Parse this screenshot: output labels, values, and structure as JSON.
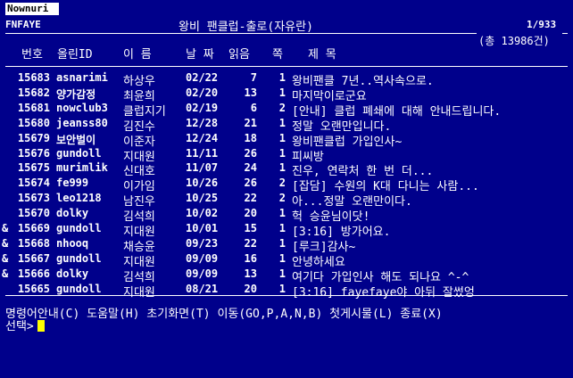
{
  "app": {
    "title": "Nownuri"
  },
  "board": {
    "code": "FNFAYE",
    "title": "왕비 팬클럽-출로(자유란)",
    "page": "1/933",
    "total": "(총 13986건)"
  },
  "columns": {
    "no": "번호",
    "id": "올린ID",
    "name": "이 름",
    "date": "날 짜",
    "read": "읽음",
    "pages": "쪽",
    "subject": "제   목"
  },
  "posts": [
    {
      "flag": "",
      "no": "15683",
      "id": "asnarimi",
      "name": "하상우",
      "date": "02/22",
      "read": "7",
      "pages": "1",
      "subject": "왕비팬클 7년..역사속으로."
    },
    {
      "flag": "",
      "no": "15682",
      "id": "양가감정",
      "name": "최윤희",
      "date": "02/20",
      "read": "13",
      "pages": "1",
      "subject": "마지막이로군요"
    },
    {
      "flag": "",
      "no": "15681",
      "id": "nowclub3",
      "name": "클럽지기",
      "date": "02/19",
      "read": "6",
      "pages": "2",
      "subject": "[안내] 클럽 폐쇄에 대해 안내드립니다."
    },
    {
      "flag": "",
      "no": "15680",
      "id": "jeanss80",
      "name": "김진수",
      "date": "12/28",
      "read": "21",
      "pages": "1",
      "subject": "정말 오랜만입니다."
    },
    {
      "flag": "",
      "no": "15679",
      "id": "보안벌이",
      "name": "이준자",
      "date": "12/24",
      "read": "18",
      "pages": "1",
      "subject": "왕비팬클럽 가입인사~"
    },
    {
      "flag": "",
      "no": "15676",
      "id": "gundoll",
      "name": "지대원",
      "date": "11/11",
      "read": "26",
      "pages": "1",
      "subject": "피씨방"
    },
    {
      "flag": "",
      "no": "15675",
      "id": "murimlik",
      "name": "신대호",
      "date": "11/07",
      "read": "24",
      "pages": "1",
      "subject": "진우, 연락처 한 번 더..."
    },
    {
      "flag": "",
      "no": "15674",
      "id": "fe999",
      "name": "이가임",
      "date": "10/26",
      "read": "26",
      "pages": "2",
      "subject": "[잡담] 수원의 K대 다니는 사람..."
    },
    {
      "flag": "",
      "no": "15673",
      "id": "leo1218",
      "name": "남진우",
      "date": "10/25",
      "read": "22",
      "pages": "2",
      "subject": "아...정말 오랜만이다."
    },
    {
      "flag": "",
      "no": "15670",
      "id": "dolky",
      "name": "김석희",
      "date": "10/02",
      "read": "20",
      "pages": "1",
      "subject": "헉 승윤님이닷!"
    },
    {
      "flag": "&",
      "no": "15669",
      "id": "gundoll",
      "name": "지대원",
      "date": "10/01",
      "read": "15",
      "pages": "1",
      "subject": "[3:16] 방가어요."
    },
    {
      "flag": "&",
      "no": "15668",
      "id": "nhooq",
      "name": "채승윤",
      "date": "09/23",
      "read": "22",
      "pages": "1",
      "subject": "[루크]감사~"
    },
    {
      "flag": "&",
      "no": "15667",
      "id": "gundoll",
      "name": "지대원",
      "date": "09/09",
      "read": "16",
      "pages": "1",
      "subject": "안녕하세요"
    },
    {
      "flag": "&",
      "no": "15666",
      "id": "dolky",
      "name": "김석희",
      "date": "09/09",
      "read": "13",
      "pages": "1",
      "subject": "여기다 가입인사 해도 되나요 ^-^"
    },
    {
      "flag": "",
      "no": "15665",
      "id": "gundoll",
      "name": "지대원",
      "date": "08/21",
      "read": "20",
      "pages": "1",
      "subject": "[3:16] fayefaye야 아뒤 잘썼엉"
    }
  ],
  "menu": {
    "text": "명령어안내(C) 도움말(H) 초기화면(T) 이동(GO,P,A,N,B) 첫게시물(L) 종료(X)"
  },
  "prompt": {
    "label": "선택>",
    "cursor_color": "#ffff00"
  },
  "colors": {
    "background": "#00008b",
    "text": "#ffffff"
  }
}
